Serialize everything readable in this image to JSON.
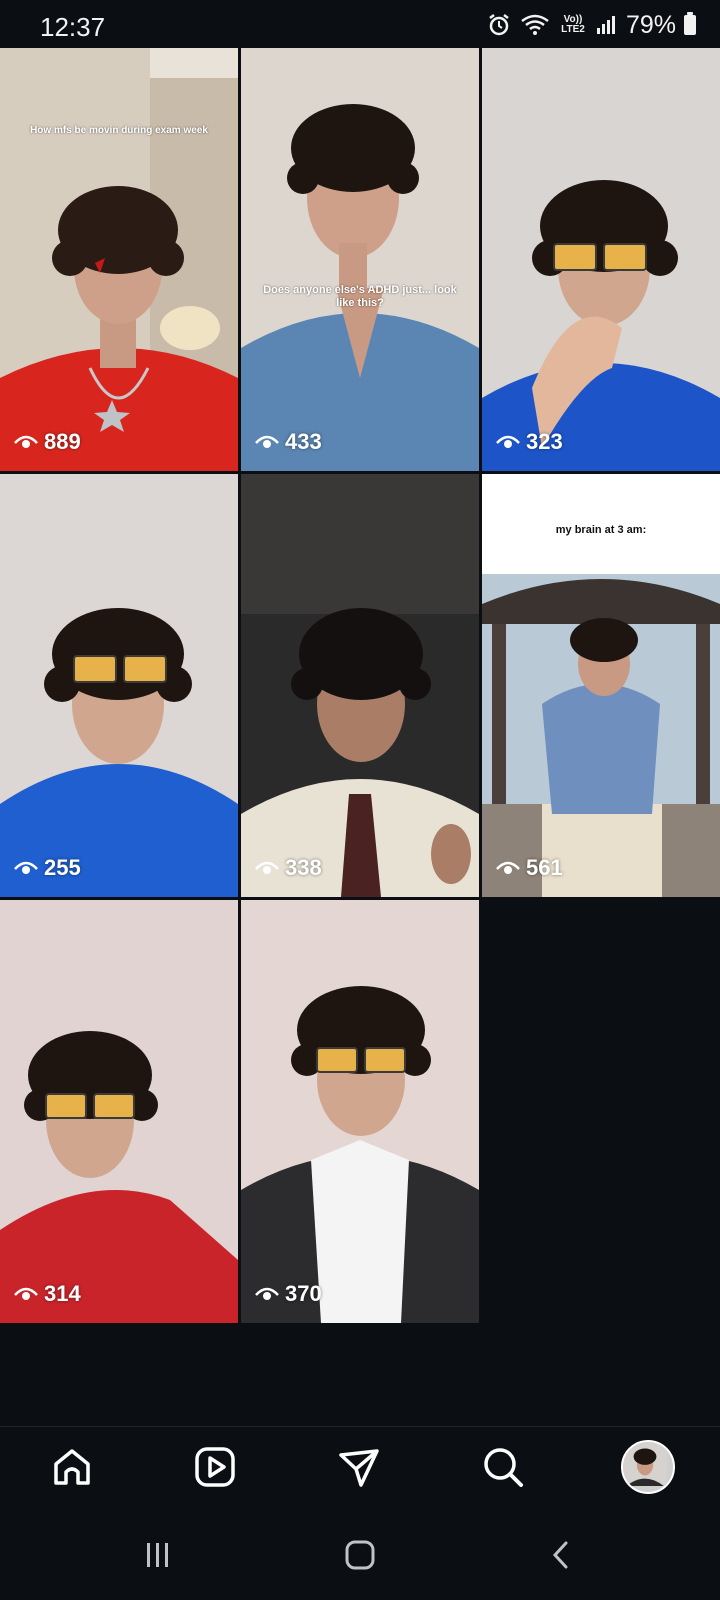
{
  "status_bar": {
    "time": "12:37",
    "network": "Vo)) LTE2",
    "battery": "79%"
  },
  "grid": {
    "tiles": [
      {
        "views": "889",
        "caption": "How mfs be movin during exam week",
        "shirt": "#d8261f",
        "bg": "#d7cdbf"
      },
      {
        "views": "433",
        "caption": "Does anyone else's ADHD just... look like this?",
        "shirt": "#5b86b3",
        "bg": "#ddd6cf"
      },
      {
        "views": "323",
        "caption": "",
        "shirt": "#1d55c8",
        "bg": "#d9d5d3"
      },
      {
        "views": "255",
        "caption": "",
        "shirt": "#1f5fcf",
        "bg": "#dcd6d5"
      },
      {
        "views": "338",
        "caption": "",
        "shirt": "#e7e2d4",
        "bg": "#2b2a2a"
      },
      {
        "views": "561",
        "caption": "my brain at 3 am:",
        "shirt": "#6f8fbf",
        "bg": "#ffffff"
      },
      {
        "views": "314",
        "caption": "",
        "shirt": "#c9242a",
        "bg": "#e0d3d1"
      },
      {
        "views": "370",
        "caption": "",
        "shirt": "#2c2c2e",
        "bg": "#e4d6d3"
      }
    ]
  },
  "nav": {
    "icons": [
      "home-icon",
      "reels-icon",
      "direct-message-icon",
      "search-icon",
      "profile-avatar"
    ]
  },
  "colors": {
    "background": "#0b0f14",
    "text": "#ffffff"
  }
}
